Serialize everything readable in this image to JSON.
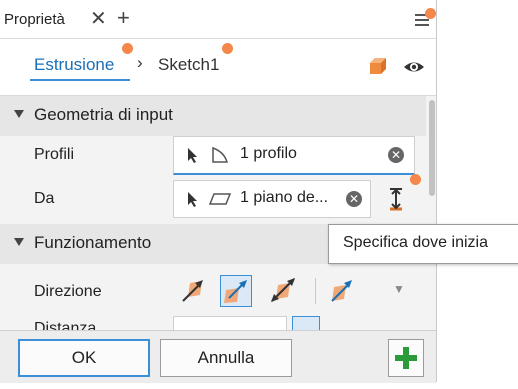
{
  "tabbar": {
    "title": "Proprietà",
    "close_glyph": "✕",
    "add_glyph": "+"
  },
  "breadcrumb": {
    "feature": "Estrusione",
    "separator": "›",
    "sketch": "Sketch1"
  },
  "sections": {
    "input": {
      "title": "Geometria di input",
      "rows": [
        {
          "label": "Profili",
          "value": "1 profilo"
        },
        {
          "label": "Da",
          "value": "1 piano de..."
        }
      ]
    },
    "behavior": {
      "title": "Funzionamento",
      "direction_label": "Direzione",
      "distance_label": "Distanza"
    }
  },
  "tooltip": "Specifica dove inizia",
  "buttons": {
    "ok": "OK",
    "cancel": "Annulla",
    "plus": "+"
  },
  "colors": {
    "accent": "#3a8fd6",
    "marker": "#f4884a",
    "add_green": "#2a9a3a"
  },
  "icons": [
    "menu-icon",
    "box-icon",
    "eye-icon",
    "cursor-icon",
    "profile-icon",
    "plane-icon",
    "clear-icon",
    "flip-icon"
  ]
}
